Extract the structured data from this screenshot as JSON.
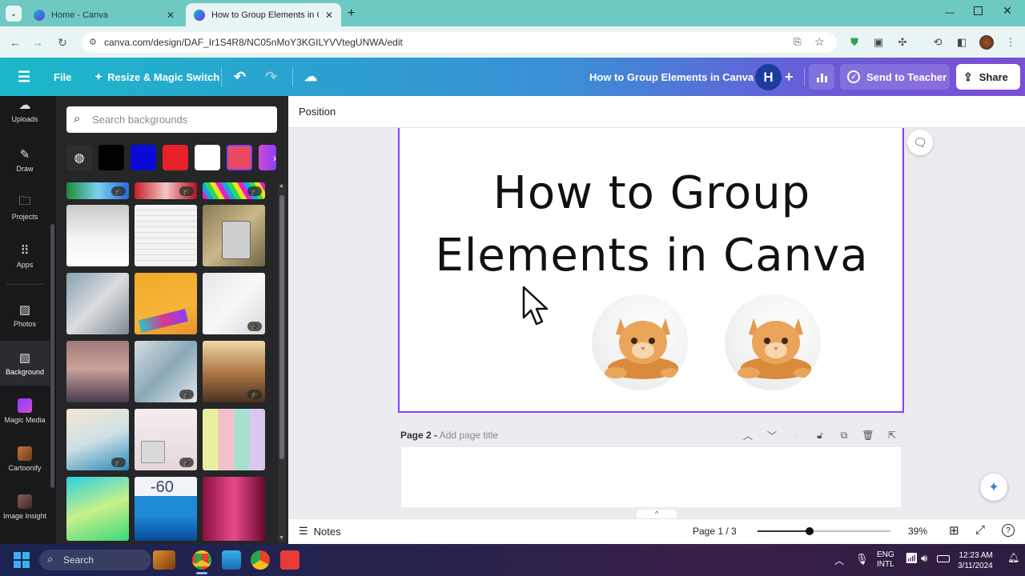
{
  "browser": {
    "tabs": [
      {
        "title": "Home - Canva",
        "active": false
      },
      {
        "title": "How to Group Elements in Canva",
        "active": true
      }
    ],
    "url": "canva.com/design/DAF_Ir1S4R8/NC05nMoY3KGILYVVtegUNWA/edit"
  },
  "header": {
    "file_label": "File",
    "resize_label": "Resize & Magic Switch",
    "doc_title": "How to Group Elements in Canva",
    "avatar_letter": "H",
    "send_label": "Send to Teacher",
    "share_label": "Share",
    "accent": "#8b3dff"
  },
  "rail": {
    "items": [
      {
        "label": "Uploads",
        "icon": "cloud-upload-icon"
      },
      {
        "label": "Draw",
        "icon": "pen-icon"
      },
      {
        "label": "Projects",
        "icon": "folder-icon"
      },
      {
        "label": "Apps",
        "icon": "apps-grid-icon"
      },
      {
        "label": "Photos",
        "icon": "image-icon"
      },
      {
        "label": "Background",
        "icon": "stripes-icon"
      },
      {
        "label": "Magic Media",
        "icon": "magic-media-icon"
      },
      {
        "label": "Cartoonify",
        "icon": "cartoonify-icon"
      },
      {
        "label": "Image Insight",
        "icon": "image-insight-icon"
      }
    ],
    "active": "Background"
  },
  "panel": {
    "search_placeholder": "Search backgrounds",
    "swatches": [
      "#000000",
      "#0a0ad8",
      "#e8202a",
      "#ffffff",
      "#e84a5f"
    ]
  },
  "canvas": {
    "toolbar_label": "Position",
    "title_line1": "How to Group",
    "title_line2": "Elements in Canva",
    "page2_label": "Page 2 -",
    "page2_placeholder": "Add page title"
  },
  "footer": {
    "notes_label": "Notes",
    "page_indicator": "Page 1 / 3",
    "zoom": "39%",
    "zoom_level": 0.39
  },
  "taskbar": {
    "search_label": "Search",
    "lang_line1": "ENG",
    "lang_line2": "INTL",
    "time": "12:23 AM",
    "date": "3/11/2024"
  }
}
